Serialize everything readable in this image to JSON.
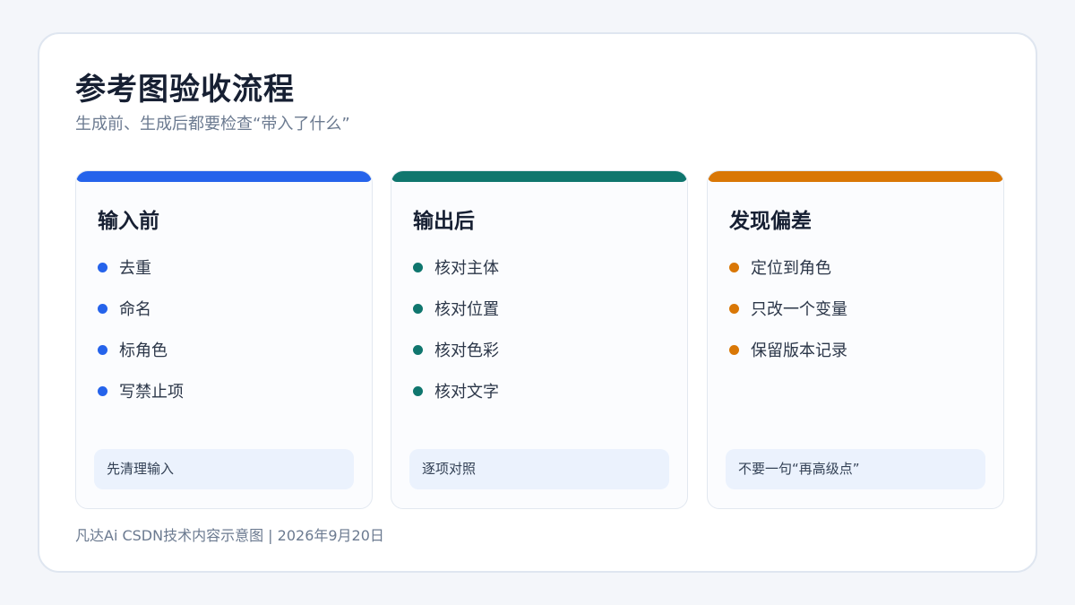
{
  "header": {
    "title": "参考图验收流程",
    "subtitle": "生成前、生成后都要检查“带入了什么”"
  },
  "cards": [
    {
      "title": "输入前",
      "accent": "#2563eb",
      "items": [
        "去重",
        "命名",
        "标角色",
        "写禁止项"
      ],
      "footer": "先清理输入"
    },
    {
      "title": "输出后",
      "accent": "#0f766e",
      "items": [
        "核对主体",
        "核对位置",
        "核对色彩",
        "核对文字"
      ],
      "footer": "逐项对照"
    },
    {
      "title": "发现偏差",
      "accent": "#d97706",
      "items": [
        "定位到角色",
        "只改一个变量",
        "保留版本记录"
      ],
      "footer": "不要一句“再高级点”"
    }
  ],
  "footer": {
    "credit": "凡达Ai CSDN技术内容示意图 | 2026年9月20日"
  }
}
